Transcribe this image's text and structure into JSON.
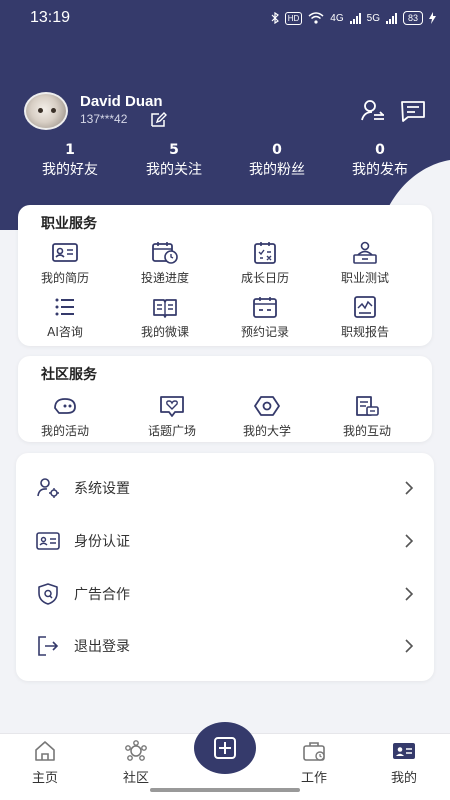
{
  "colors": {
    "primary": "#353a6b",
    "background": "#f2f3f7",
    "card": "#ffffff"
  },
  "status_bar": {
    "time": "13:19",
    "hd": "HD",
    "net_a": "4G",
    "net_b": "5G",
    "battery": "83"
  },
  "profile": {
    "name": "David Duan",
    "phone": "137***42",
    "avatar_icon": "cat-avatar",
    "edit_icon": "edit-icon"
  },
  "header_actions": [
    {
      "icon": "switch-user-icon"
    },
    {
      "icon": "message-icon"
    }
  ],
  "stats": [
    {
      "value": "1",
      "label": "我的好友"
    },
    {
      "value": "5",
      "label": "我的关注"
    },
    {
      "value": "0",
      "label": "我的粉丝"
    },
    {
      "value": "0",
      "label": "我的发布"
    }
  ],
  "career": {
    "title": "职业服务",
    "items": [
      {
        "label": "我的简历",
        "icon": "resume-icon"
      },
      {
        "label": "投递进度",
        "icon": "progress-icon"
      },
      {
        "label": "成长日历",
        "icon": "calendar-icon"
      },
      {
        "label": "职业测试",
        "icon": "test-icon"
      },
      {
        "label": "AI咨询",
        "icon": "list-icon"
      },
      {
        "label": "我的微课",
        "icon": "book-icon"
      },
      {
        "label": "预约记录",
        "icon": "appointment-icon"
      },
      {
        "label": "职规报告",
        "icon": "report-icon"
      }
    ]
  },
  "community": {
    "title": "社区服务",
    "items": [
      {
        "label": "我的活动",
        "icon": "activity-icon"
      },
      {
        "label": "话题广场",
        "icon": "topic-icon"
      },
      {
        "label": "我的大学",
        "icon": "university-icon"
      },
      {
        "label": "我的互动",
        "icon": "interaction-icon"
      }
    ]
  },
  "settings": [
    {
      "label": "系统设置",
      "icon": "user-settings-icon"
    },
    {
      "label": "身份认证",
      "icon": "id-card-icon"
    },
    {
      "label": "广告合作",
      "icon": "shield-icon"
    },
    {
      "label": "退出登录",
      "icon": "logout-icon"
    }
  ],
  "nav": {
    "items": [
      {
        "label": "主页",
        "icon": "home-icon"
      },
      {
        "label": "社区",
        "icon": "community-icon"
      },
      {
        "label": "工作",
        "icon": "work-icon"
      },
      {
        "label": "我的",
        "icon": "profile-icon"
      }
    ],
    "center_icon": "add-icon"
  }
}
